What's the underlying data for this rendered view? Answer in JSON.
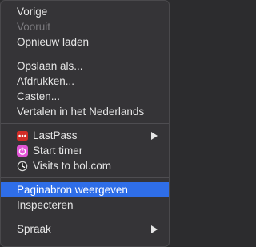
{
  "menu": {
    "items": [
      {
        "label": "Vorige"
      },
      {
        "label": "Vooruit"
      },
      {
        "label": "Opnieuw laden"
      },
      {
        "label": "Opslaan als..."
      },
      {
        "label": "Afdrukken..."
      },
      {
        "label": "Casten..."
      },
      {
        "label": "Vertalen in het Nederlands"
      },
      {
        "label": "LastPass",
        "icon": "lastpass-icon"
      },
      {
        "label": "Start timer",
        "icon": "power-timer-icon"
      },
      {
        "label": "Visits to bol.com",
        "icon": "clock-icon"
      },
      {
        "label": "Paginabron weergeven"
      },
      {
        "label": "Inspecteren"
      },
      {
        "label": "Spraak"
      }
    ]
  },
  "colors": {
    "menu_background": "#353437",
    "highlight": "#2f6ee8",
    "text": "#e6e6e6",
    "disabled_text": "#7b7a7e",
    "lastpass_red": "#d32d27",
    "timer_pink": "#e255d6"
  }
}
